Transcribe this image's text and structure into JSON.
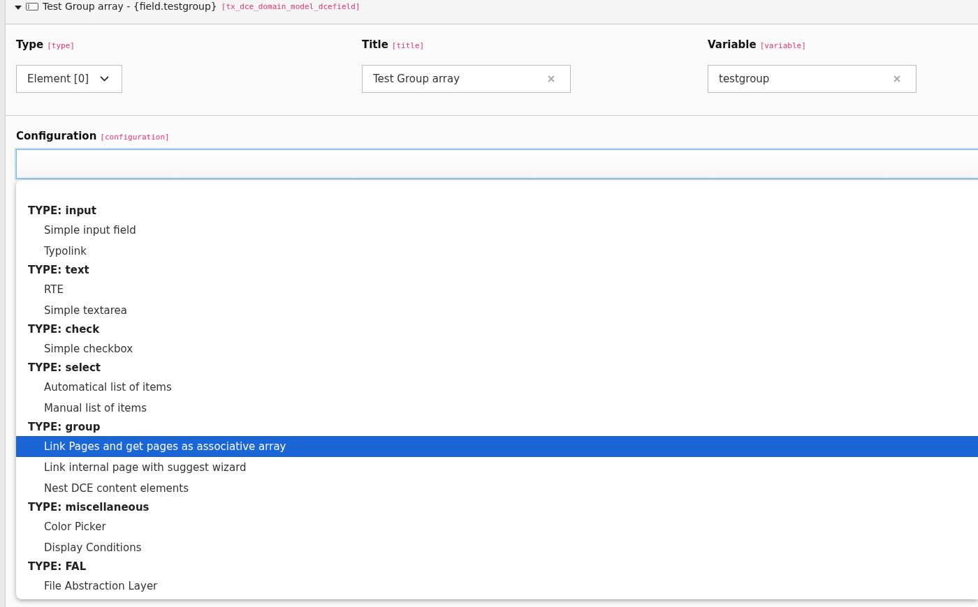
{
  "header": {
    "expanded": true,
    "title": "Test Group array - {field.testgroup}",
    "table": "[tx_dce_domain_model_dcefield]"
  },
  "fields": [
    {
      "kind": "select",
      "label": "Type",
      "key": "[type]",
      "value": "Element [0]"
    },
    {
      "kind": "text",
      "label": "Title",
      "key": "[title]",
      "value": "Test Group array"
    },
    {
      "kind": "text",
      "label": "Variable",
      "key": "[variable]",
      "value": "testgroup"
    }
  ],
  "configuration": {
    "label": "Configuration",
    "key": "[configuration]",
    "groups": [
      {
        "label": "TYPE: input",
        "options": [
          {
            "label": "Simple input field",
            "selected": false
          },
          {
            "label": "Typolink",
            "selected": false
          }
        ]
      },
      {
        "label": "TYPE: text",
        "options": [
          {
            "label": "RTE",
            "selected": false
          },
          {
            "label": "Simple textarea",
            "selected": false
          }
        ]
      },
      {
        "label": "TYPE: check",
        "options": [
          {
            "label": "Simple checkbox",
            "selected": false
          }
        ]
      },
      {
        "label": "TYPE: select",
        "options": [
          {
            "label": "Automatical list of items",
            "selected": false
          },
          {
            "label": "Manual list of items",
            "selected": false
          }
        ]
      },
      {
        "label": "TYPE: group",
        "options": [
          {
            "label": "Link Pages and get pages as associative array",
            "selected": true
          },
          {
            "label": "Link internal page with suggest wizard",
            "selected": false
          },
          {
            "label": "Nest DCE content elements",
            "selected": false
          }
        ]
      },
      {
        "label": "TYPE: miscellaneous",
        "options": [
          {
            "label": "Color Picker",
            "selected": false
          },
          {
            "label": "Display Conditions",
            "selected": false
          }
        ]
      },
      {
        "label": "TYPE: FAL",
        "options": [
          {
            "label": "File Abstraction Layer",
            "selected": false
          }
        ]
      }
    ]
  }
}
